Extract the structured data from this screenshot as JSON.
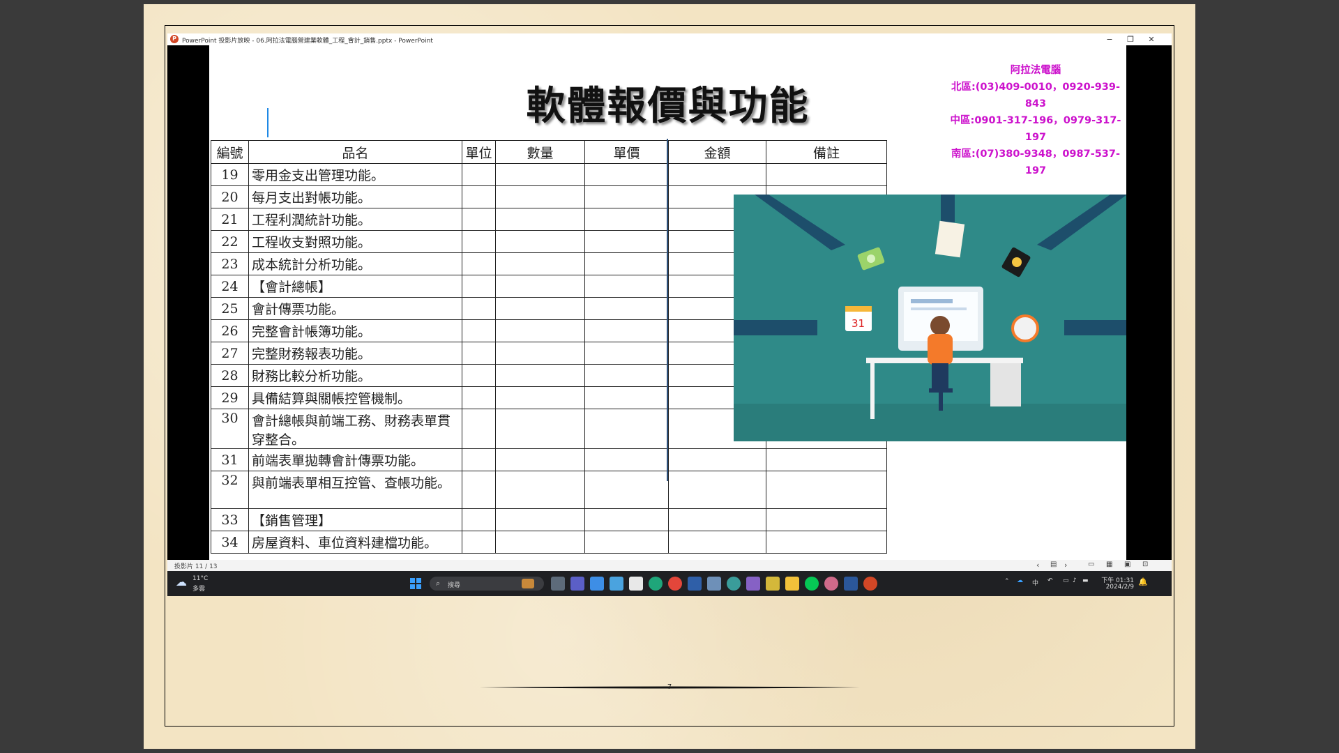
{
  "window": {
    "title": "PowerPoint 投影片放映 - 06.阿拉法電腦營建業軟體_工程_會計_銷售.pptx - PowerPoint",
    "minimize": "−",
    "restore": "❐",
    "close": "✕"
  },
  "slide": {
    "title": "軟體報價與功能",
    "contact": {
      "company": "阿拉法電腦",
      "north": "北區:(03)409-0010，0920-939-843",
      "central": "中區:0901-317-196，0979-317-197",
      "south": "南區:(07)380-9348，0987-537-197"
    },
    "table": {
      "headers": [
        "編號",
        "品名",
        "單位",
        "數量",
        "單價",
        "金額",
        "備註"
      ],
      "rows": [
        {
          "num": "19",
          "name": "零用金支出管理功能。"
        },
        {
          "num": "20",
          "name": "每月支出對帳功能。"
        },
        {
          "num": "21",
          "name": "工程利潤統計功能。"
        },
        {
          "num": "22",
          "name": "工程收支對照功能。"
        },
        {
          "num": "23",
          "name": "成本統計分析功能。"
        },
        {
          "num": "24",
          "name": "【會計總帳】"
        },
        {
          "num": "25",
          "name": "會計傳票功能。"
        },
        {
          "num": "26",
          "name": "完整會計帳簿功能。"
        },
        {
          "num": "27",
          "name": "完整財務報表功能。"
        },
        {
          "num": "28",
          "name": "財務比較分析功能。"
        },
        {
          "num": "29",
          "name": "具備結算與關帳控管機制。"
        },
        {
          "num": "30",
          "name": "會計總帳與前端工務、財務表單貫穿整合。"
        },
        {
          "num": "31",
          "name": "前端表單拋轉會計傳票功能。"
        },
        {
          "num": "32",
          "name": "與前端表單相互控管、查帳功能。"
        },
        {
          "num": "33",
          "name": "【銷售管理】"
        },
        {
          "num": "34",
          "name": "房屋資料、車位資料建檔功能。"
        }
      ]
    }
  },
  "statusbar": {
    "slide_counter": "投影片 11 / 13"
  },
  "taskbar": {
    "weather_temp": "11°C",
    "weather_desc": "多雲",
    "search_placeholder": "搜尋",
    "ime": "中",
    "time": "下午 01:31",
    "date": "2024/2/9"
  },
  "page": {
    "number": "7"
  }
}
